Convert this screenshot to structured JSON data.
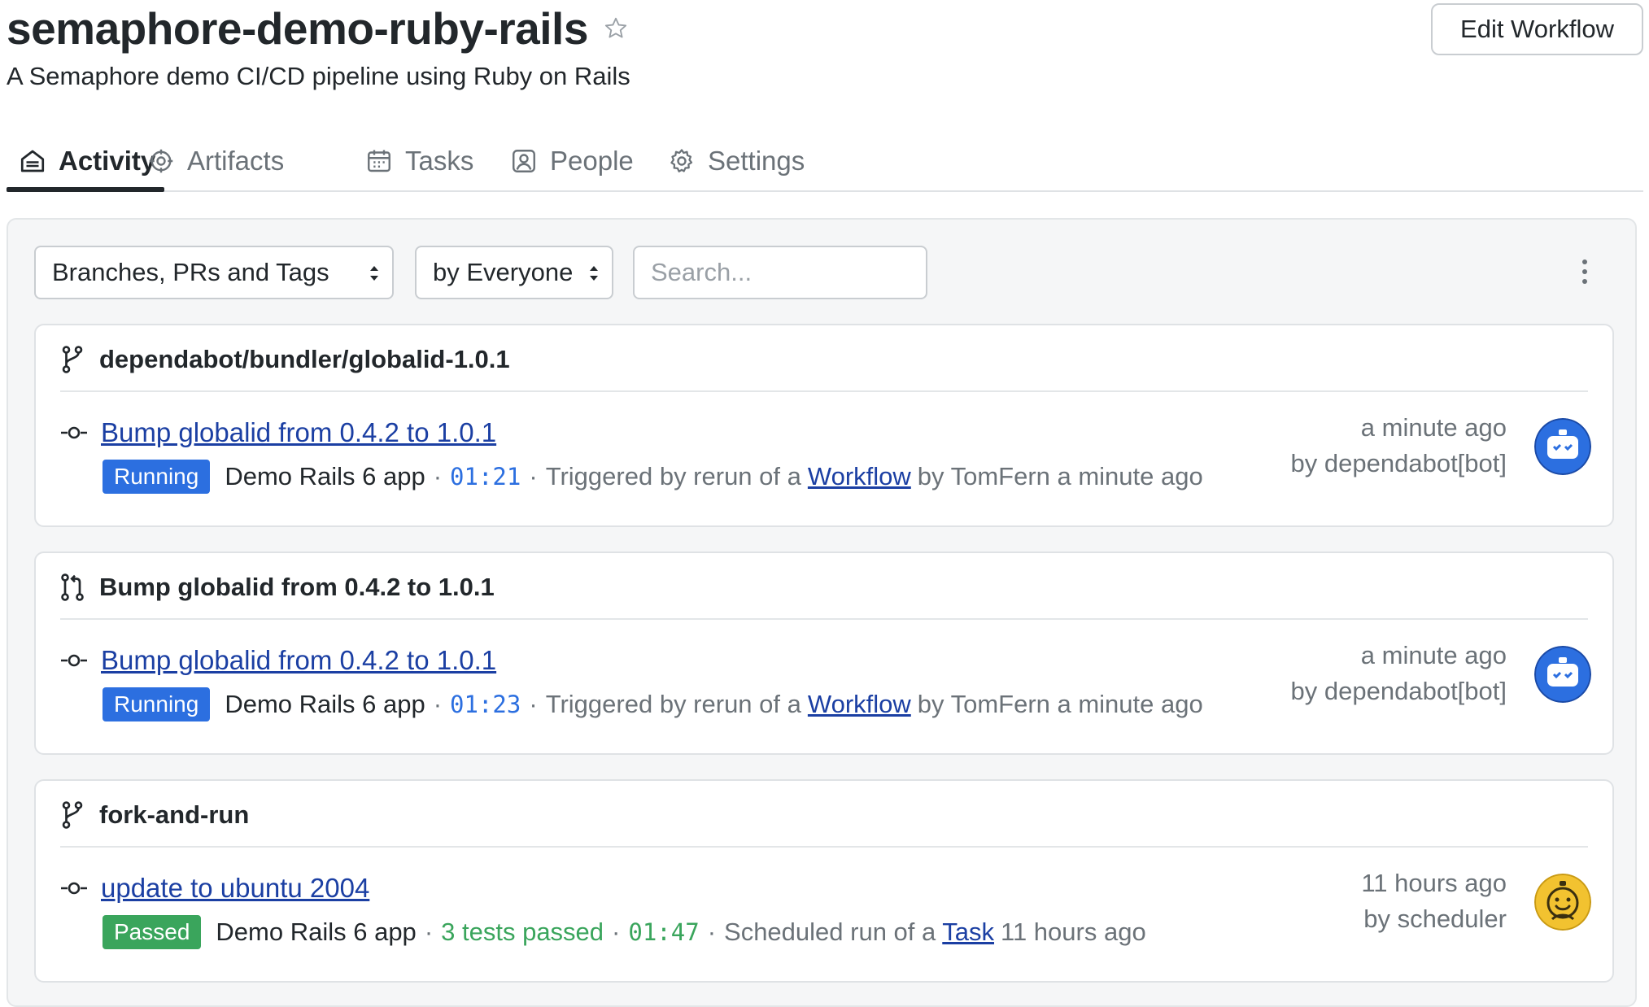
{
  "header": {
    "project_title": "semaphore-demo-ruby-rails",
    "description": "A Semaphore demo CI/CD pipeline using Ruby on Rails",
    "edit_label": "Edit Workflow"
  },
  "tabs": [
    {
      "label": "Activity",
      "icon": "home-icon",
      "active": true
    },
    {
      "label": "Artifacts",
      "icon": "artifacts-icon",
      "active": false
    },
    {
      "label": "Tasks",
      "icon": "calendar-icon",
      "active": false
    },
    {
      "label": "People",
      "icon": "person-icon",
      "active": false
    },
    {
      "label": "Settings",
      "icon": "gear-icon",
      "active": false
    }
  ],
  "filters": {
    "type_select": "Branches, PRs and Tags",
    "user_select": "by Everyone",
    "search_placeholder": "Search..."
  },
  "cards": [
    {
      "kind": "branch",
      "title": "dependabot/bundler/globalid-1.0.1",
      "commit": "Bump globalid from 0.4.2 to 1.0.1",
      "status": "Running",
      "pipeline": "Demo Rails 6 app",
      "duration": "01:21",
      "trigger_prefix": "Triggered by rerun of a",
      "trigger_link": "Workflow",
      "trigger_suffix": "by TomFern a minute ago",
      "time": "a minute ago",
      "author": "by dependabot[bot]",
      "avatar": "robot-avatar"
    },
    {
      "kind": "pull-request",
      "title": "Bump globalid from 0.4.2 to 1.0.1",
      "commit": "Bump globalid from 0.4.2 to 1.0.1",
      "status": "Running",
      "pipeline": "Demo Rails 6 app",
      "duration": "01:23",
      "trigger_prefix": "Triggered by rerun of a",
      "trigger_link": "Workflow",
      "trigger_suffix": "by TomFern a minute ago",
      "time": "a minute ago",
      "author": "by dependabot[bot]",
      "avatar": "robot-avatar"
    },
    {
      "kind": "branch",
      "title": "fork-and-run",
      "commit": "update to ubuntu 2004",
      "status": "Passed",
      "pipeline": "Demo Rails 6 app",
      "tests": "3 tests passed",
      "duration": "01:47",
      "trigger_prefix": "Scheduled run of a",
      "trigger_link": "Task",
      "trigger_suffix": "11 hours ago",
      "time": "11 hours ago",
      "author": "by scheduler",
      "avatar": "scheduler-avatar"
    }
  ],
  "colors": {
    "link": "#1b3fa3",
    "running": "#2c6fe0",
    "passed": "#3aa55c",
    "robot_avatar": "#2c6fe0",
    "scheduler_avatar": "#f2c230"
  }
}
